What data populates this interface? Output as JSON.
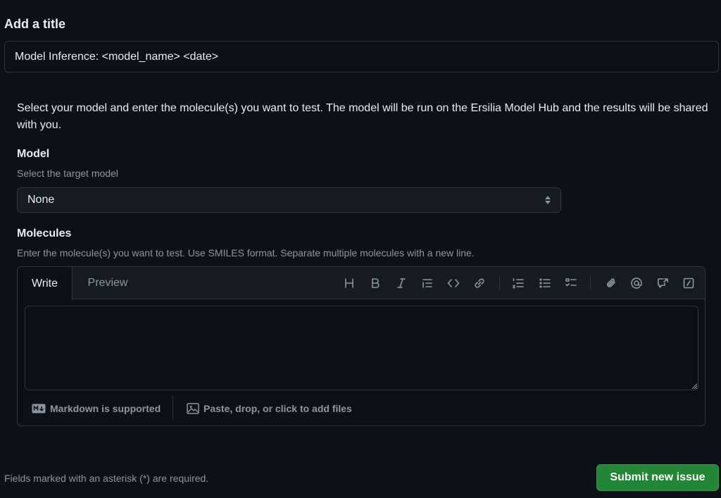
{
  "title_section": {
    "label": "Add a title",
    "value": "Model Inference: <model_name> <date>"
  },
  "intro": "Select your model and enter the molecule(s) you want to test. The model will be run on the Ersilia Model Hub and the results will be shared with you.",
  "model_field": {
    "label": "Model",
    "description": "Select the target model",
    "selected": "None"
  },
  "molecules_field": {
    "label": "Molecules",
    "description": "Enter the molecule(s) you want to test. Use SMILES format. Separate multiple molecules with a new line.",
    "tabs": [
      "Write",
      "Preview"
    ],
    "toolbar_icons": [
      "heading-icon",
      "bold-icon",
      "italic-icon",
      "quote-icon",
      "code-icon",
      "link-icon",
      "numbered-list-icon",
      "unordered-list-icon",
      "task-list-icon",
      "attach-icon",
      "mention-icon",
      "reference-icon",
      "slash-commands-icon"
    ],
    "value": "",
    "markdown_note": "Markdown is supported",
    "attach_note": "Paste, drop, or click to add files"
  },
  "footer": {
    "required_note": "Fields marked with an asterisk (*) are required.",
    "submit_label": "Submit new issue"
  },
  "colors": {
    "background": "#0d1117",
    "border": "#30363d",
    "muted_text": "#8d96a0",
    "primary_button": "#238636"
  }
}
